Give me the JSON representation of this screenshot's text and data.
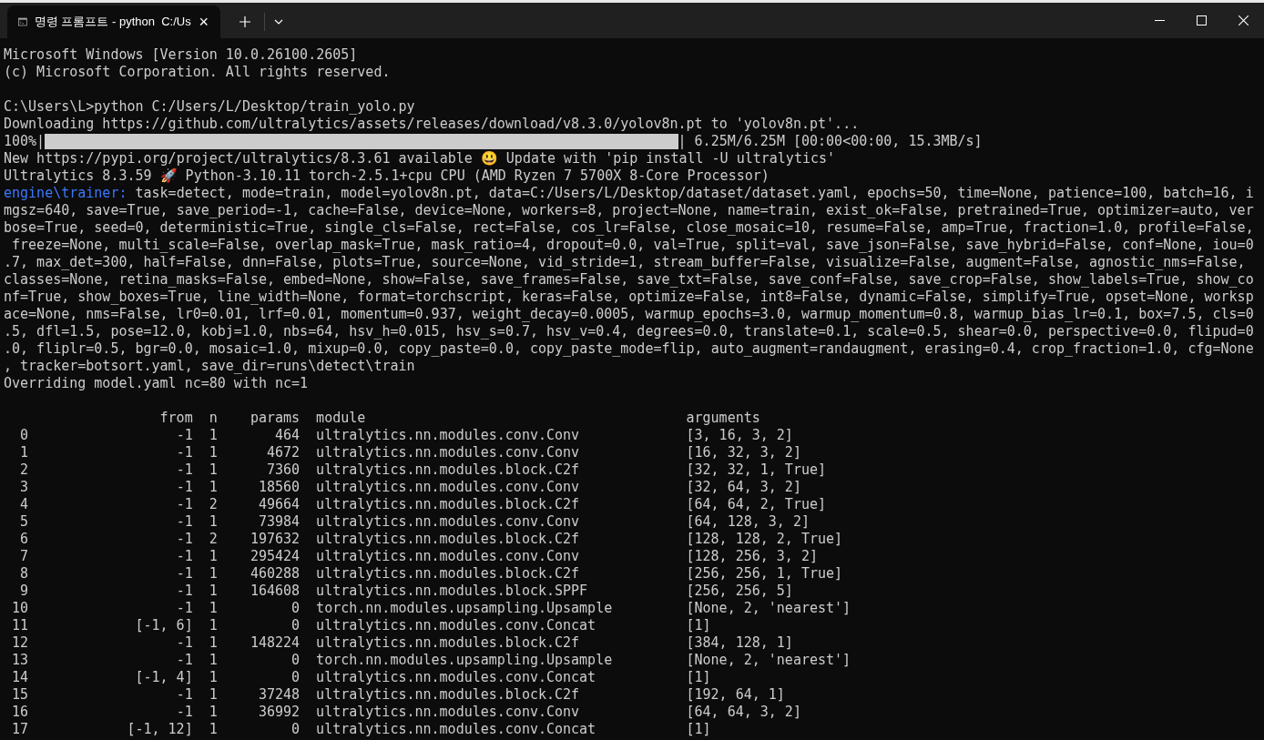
{
  "tabs": [
    {
      "title": "명령 프롬프트 - python  C:/Us",
      "selected": true,
      "close": "×"
    }
  ],
  "console": {
    "lines": [
      {
        "kind": "text",
        "text": "Microsoft Windows [Version 10.0.26100.2605]"
      },
      {
        "kind": "text",
        "text": "(c) Microsoft Corporation. All rights reserved."
      },
      {
        "kind": "blank"
      },
      {
        "kind": "text",
        "text": "C:\\Users\\L>python C:/Users/L/Desktop/train_yolo.py"
      },
      {
        "kind": "text",
        "text": "Downloading https://github.com/ultralytics/assets/releases/download/v8.3.0/yolov8n.pt to 'yolov8n.pt'..."
      },
      {
        "kind": "progress",
        "label": "100%|",
        "level": 1,
        "reading": "| 6.25M/6.25M [00:00<00:00, 15.3MB/s]"
      },
      {
        "kind": "text",
        "text": "New https://pypi.org/project/ultralytics/8.3.61 available 😃 Update with 'pip install -U ultralytics'"
      },
      {
        "kind": "text",
        "text": "Ultralytics 8.3.59 🚀 Python-3.10.11 torch-2.5.1+cpu CPU (AMD Ryzen 7 5700X 8-Core Processor)"
      },
      {
        "kind": "prefixed",
        "prefix": "engine\\trainer:",
        "text": "task=detect, mode=train, model=yolov8n.pt, data=C:/Users/L/Desktop/dataset/dataset.yaml, epochs=50, time=None, patience=100, batch=16, i"
      },
      {
        "kind": "text",
        "text": "mgsz=640, save=True, save_period=-1, cache=False, device=None, workers=8, project=None, name=train, exist_ok=False, pretrained=True, optimizer=auto, ver"
      },
      {
        "kind": "text",
        "text": "bose=True, seed=0, deterministic=True, single_cls=False, rect=False, cos_lr=False, close_mosaic=10, resume=False, amp=True, fraction=1.0, profile=False,"
      },
      {
        "kind": "text",
        "text": " freeze=None, multi_scale=False, overlap_mask=True, mask_ratio=4, dropout=0.0, val=True, split=val, save_json=False, save_hybrid=False, conf=None, iou=0"
      },
      {
        "kind": "text",
        "text": ".7, max_det=300, half=False, dnn=False, plots=True, source=None, vid_stride=1, stream_buffer=False, visualize=False, augment=False, agnostic_nms=False,"
      },
      {
        "kind": "text",
        "text": "classes=None, retina_masks=False, embed=None, show=False, save_frames=False, save_txt=False, save_conf=False, save_crop=False, show_labels=True, show_co"
      },
      {
        "kind": "text",
        "text": "nf=True, show_boxes=True, line_width=None, format=torchscript, keras=False, optimize=False, int8=False, dynamic=False, simplify=True, opset=None, worksp"
      },
      {
        "kind": "text",
        "text": "ace=None, nms=False, lr0=0.01, lrf=0.01, momentum=0.937, weight_decay=0.0005, warmup_epochs=3.0, warmup_momentum=0.8, warmup_bias_lr=0.1, box=7.5, cls=0"
      },
      {
        "kind": "text",
        "text": ".5, dfl=1.5, pose=12.0, kobj=1.0, nbs=64, hsv_h=0.015, hsv_s=0.7, hsv_v=0.4, degrees=0.0, translate=0.1, scale=0.5, shear=0.0, perspective=0.0, flipud=0"
      },
      {
        "kind": "text",
        "text": ".0, fliplr=0.5, bgr=0.0, mosaic=1.0, mixup=0.0, copy_paste=0.0, copy_paste_mode=flip, auto_augment=randaugment, erasing=0.4, crop_fraction=1.0, cfg=None"
      },
      {
        "kind": "text",
        "text": ", tracker=botsort.yaml, save_dir=runs\\detect\\train"
      },
      {
        "kind": "text",
        "text": "Overriding model.yaml nc=80 with nc=1"
      },
      {
        "kind": "blank"
      }
    ],
    "layer_table": {
      "columns": [
        "",
        "from",
        "n",
        "params",
        "module",
        "arguments"
      ],
      "rows": [
        [
          "0",
          "-1",
          "1",
          "464",
          "ultralytics.nn.modules.conv.Conv",
          "[3, 16, 3, 2]"
        ],
        [
          "1",
          "-1",
          "1",
          "4672",
          "ultralytics.nn.modules.conv.Conv",
          "[16, 32, 3, 2]"
        ],
        [
          "2",
          "-1",
          "1",
          "7360",
          "ultralytics.nn.modules.block.C2f",
          "[32, 32, 1, True]"
        ],
        [
          "3",
          "-1",
          "1",
          "18560",
          "ultralytics.nn.modules.conv.Conv",
          "[32, 64, 3, 2]"
        ],
        [
          "4",
          "-1",
          "2",
          "49664",
          "ultralytics.nn.modules.block.C2f",
          "[64, 64, 2, True]"
        ],
        [
          "5",
          "-1",
          "1",
          "73984",
          "ultralytics.nn.modules.conv.Conv",
          "[64, 128, 3, 2]"
        ],
        [
          "6",
          "-1",
          "2",
          "197632",
          "ultralytics.nn.modules.block.C2f",
          "[128, 128, 2, True]"
        ],
        [
          "7",
          "-1",
          "1",
          "295424",
          "ultralytics.nn.modules.conv.Conv",
          "[128, 256, 3, 2]"
        ],
        [
          "8",
          "-1",
          "1",
          "460288",
          "ultralytics.nn.modules.block.C2f",
          "[256, 256, 1, True]"
        ],
        [
          "9",
          "-1",
          "1",
          "164608",
          "ultralytics.nn.modules.block.SPPF",
          "[256, 256, 5]"
        ],
        [
          "10",
          "-1",
          "1",
          "0",
          "torch.nn.modules.upsampling.Upsample",
          "[None, 2, 'nearest']"
        ],
        [
          "11",
          "[-1, 6]",
          "1",
          "0",
          "ultralytics.nn.modules.conv.Concat",
          "[1]"
        ],
        [
          "12",
          "-1",
          "1",
          "148224",
          "ultralytics.nn.modules.block.C2f",
          "[384, 128, 1]"
        ],
        [
          "13",
          "-1",
          "1",
          "0",
          "torch.nn.modules.upsampling.Upsample",
          "[None, 2, 'nearest']"
        ],
        [
          "14",
          "[-1, 4]",
          "1",
          "0",
          "ultralytics.nn.modules.conv.Concat",
          "[1]"
        ],
        [
          "15",
          "-1",
          "1",
          "37248",
          "ultralytics.nn.modules.block.C2f",
          "[192, 64, 1]"
        ],
        [
          "16",
          "-1",
          "1",
          "36992",
          "ultralytics.nn.modules.conv.Conv",
          "[64, 64, 3, 2]"
        ],
        [
          "17",
          "[-1, 12]",
          "1",
          "0",
          "ultralytics.nn.modules.conv.Concat",
          "[1]"
        ]
      ]
    }
  }
}
